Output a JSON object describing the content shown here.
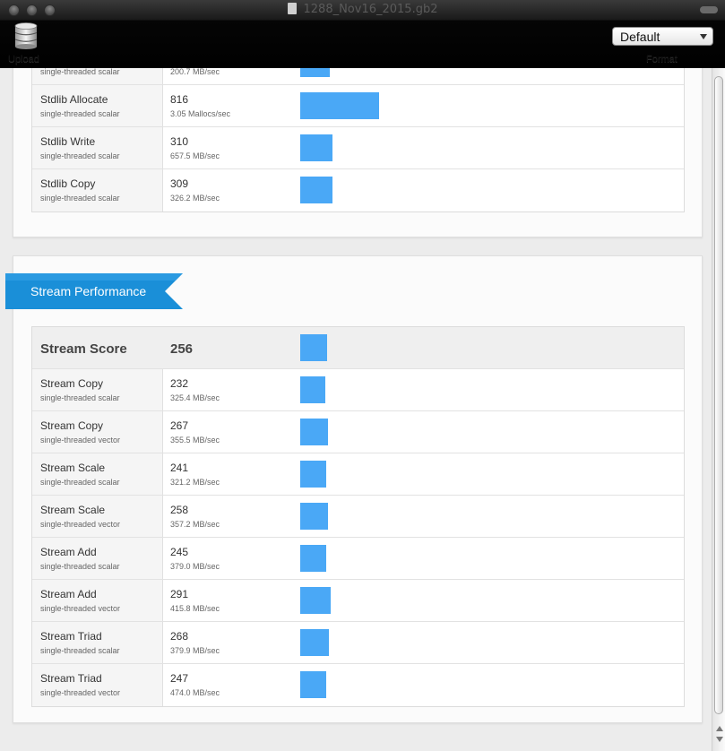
{
  "window": {
    "title": "1288_Nov16_2015.gb2"
  },
  "toolbar": {
    "upload_label": "Upload",
    "format_label": "Format",
    "format_value": "Default",
    "icons": [
      "database-icon"
    ]
  },
  "colors": {
    "bar": "#4aa8f6",
    "ribbon": "#1a8fd8"
  },
  "memory": {
    "rows": [
      {
        "name": "",
        "sub": "single-threaded scalar",
        "score": "",
        "rate": "200.7 MB/sec",
        "value": 286
      },
      {
        "name": "Stdlib Allocate",
        "sub": "single-threaded scalar",
        "score": "816",
        "rate": "3.05 Mallocs/sec",
        "value": 816
      },
      {
        "name": "Stdlib Write",
        "sub": "single-threaded scalar",
        "score": "310",
        "rate": "657.5 MB/sec",
        "value": 310
      },
      {
        "name": "Stdlib Copy",
        "sub": "single-threaded scalar",
        "score": "309",
        "rate": "326.2 MB/sec",
        "value": 309
      }
    ]
  },
  "stream": {
    "section_title": "Stream Performance",
    "summary": {
      "name": "Stream Score",
      "score": "256",
      "value": 256
    },
    "rows": [
      {
        "name": "Stream Copy",
        "sub": "single-threaded scalar",
        "score": "232",
        "rate": "325.4 MB/sec",
        "value": 232
      },
      {
        "name": "Stream Copy",
        "sub": "single-threaded vector",
        "score": "267",
        "rate": "355.5 MB/sec",
        "value": 267
      },
      {
        "name": "Stream Scale",
        "sub": "single-threaded scalar",
        "score": "241",
        "rate": "321.2 MB/sec",
        "value": 241
      },
      {
        "name": "Stream Scale",
        "sub": "single-threaded vector",
        "score": "258",
        "rate": "357.2 MB/sec",
        "value": 258
      },
      {
        "name": "Stream Add",
        "sub": "single-threaded scalar",
        "score": "245",
        "rate": "379.0 MB/sec",
        "value": 245
      },
      {
        "name": "Stream Add",
        "sub": "single-threaded vector",
        "score": "291",
        "rate": "415.8 MB/sec",
        "value": 291
      },
      {
        "name": "Stream Triad",
        "sub": "single-threaded scalar",
        "score": "268",
        "rate": "379.9 MB/sec",
        "value": 268
      },
      {
        "name": "Stream Triad",
        "sub": "single-threaded vector",
        "score": "247",
        "rate": "474.0 MB/sec",
        "value": 247
      }
    ]
  }
}
